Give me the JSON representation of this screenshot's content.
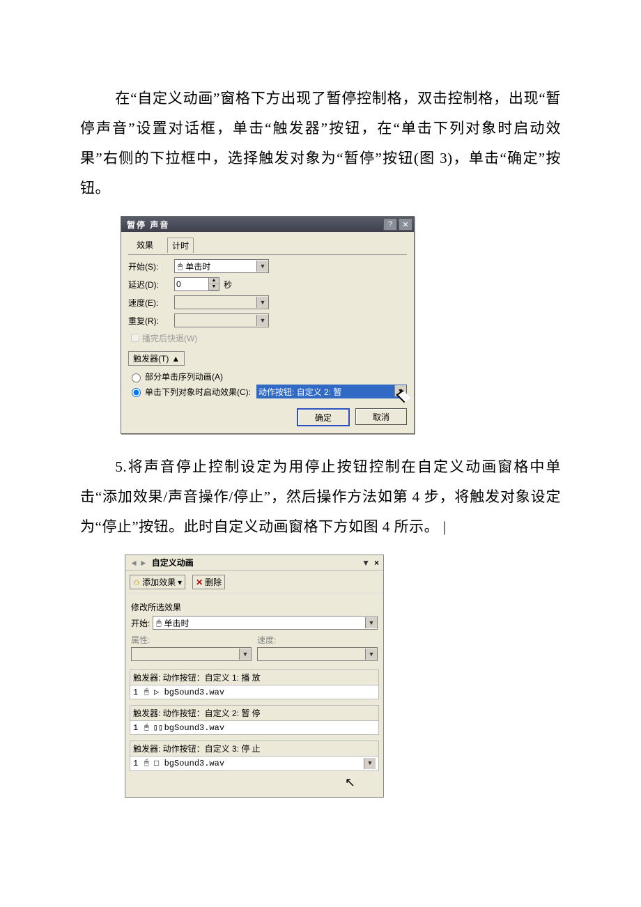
{
  "para1": "在“自定义动画”窗格下方出现了暂停控制格，双击控制格，出现“暂停声音”设置对话框，单击“触发器”按钮，在“单击下列对象时启动效果”右侧的下拉框中，选择触发对象为“暂停”按钮(图 3)，单击“确定”按钮。",
  "para2": "5.将声音停止控制设定为用停止按钮控制在自定义动画窗格中单击“添加效果/声音操作/停止”，然后操作方法如第 4 步，将触发对象设定为“停止”按钮。此时自定义动画窗格下方如图 4 所示。  |",
  "dialog": {
    "title": "暂停  声音",
    "tabs": {
      "effect": "效果",
      "timing": "计时"
    },
    "start_label": "开始(S):",
    "start_value": "单击时",
    "delay_label": "延迟(D):",
    "delay_value": "0",
    "delay_unit": "秒",
    "speed_label": "速度(E):",
    "repeat_label": "重复(R):",
    "rewind": "播完后快退(W)",
    "trigger_btn": "触发器(T)",
    "radio_part": "部分单击序列动画(A)",
    "radio_click": "单击下列对象时启动效果(C):",
    "trigger_value": "动作按钮: 自定义 2: 暂",
    "ok": "确定",
    "cancel": "取消"
  },
  "pane": {
    "title": "自定义动画",
    "add_effect": "添加效果",
    "remove": "删除",
    "modify": "修改所选效果",
    "start_label": "开始:",
    "start_value": "单击时",
    "prop_label": "属性:",
    "speed_label": "速度:",
    "groups": [
      {
        "head": "触发器: 动作按钮：自定义 1: 播   放",
        "icon": "▷",
        "item": "bgSound3.wav"
      },
      {
        "head": "触发器: 动作按钮：自定义 2: 暂   停",
        "icon": "▯▯",
        "item": "bgSound3.wav"
      },
      {
        "head": "触发器: 动作按钮：自定义 3: 停  止",
        "icon": "□",
        "item": "bgSound3.wav"
      }
    ],
    "order": "1",
    "mouse_glyph": "↯",
    "cursor_glyph": "↖"
  }
}
